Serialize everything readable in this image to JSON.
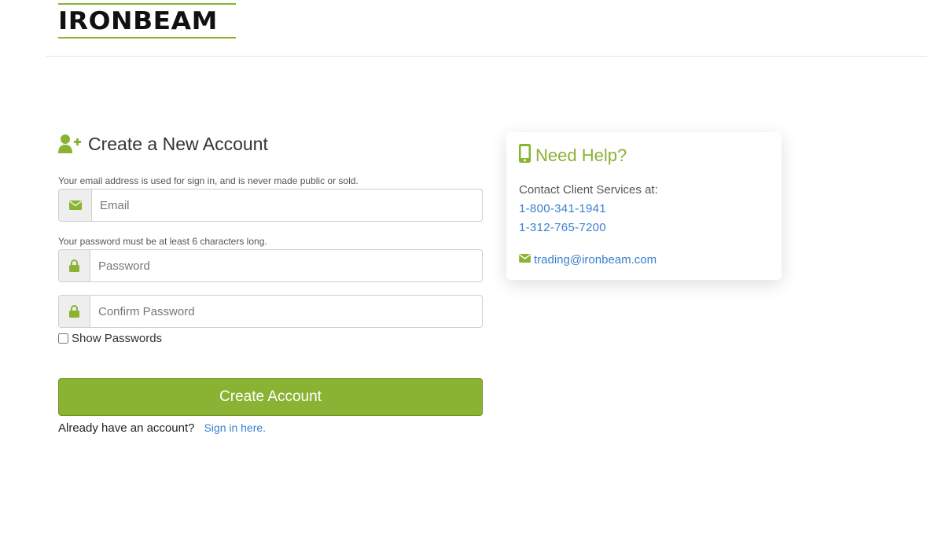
{
  "brand": {
    "logo_text": "IRONBEAM",
    "accent_color": "#8ab333",
    "link_color": "#3a7fd0"
  },
  "form": {
    "title": "Create a New Account",
    "title_icon": "user-plus-icon",
    "email_hint": "Your email address is used for sign in, and is never made public or sold.",
    "email_placeholder": "Email",
    "email_value": "",
    "email_icon": "envelope-icon",
    "password_hint": "Your password must be at least 6 characters long.",
    "password_placeholder": "Password",
    "password_value": "",
    "password_icon": "lock-icon",
    "confirm_placeholder": "Confirm Password",
    "confirm_value": "",
    "confirm_icon": "lock-icon",
    "show_passwords_label": "Show Passwords",
    "show_passwords_checked": false,
    "submit_label": "Create Account",
    "signin_prompt": "Already have an account?",
    "signin_link": "Sign in here."
  },
  "help": {
    "title": "Need Help?",
    "title_icon": "mobile-phone-icon",
    "contact_label": "Contact Client Services at:",
    "phone_1": "1-800-341-1941",
    "phone_2": "1-312-765-7200",
    "email": "trading@ironbeam.com",
    "email_icon": "envelope-icon"
  }
}
